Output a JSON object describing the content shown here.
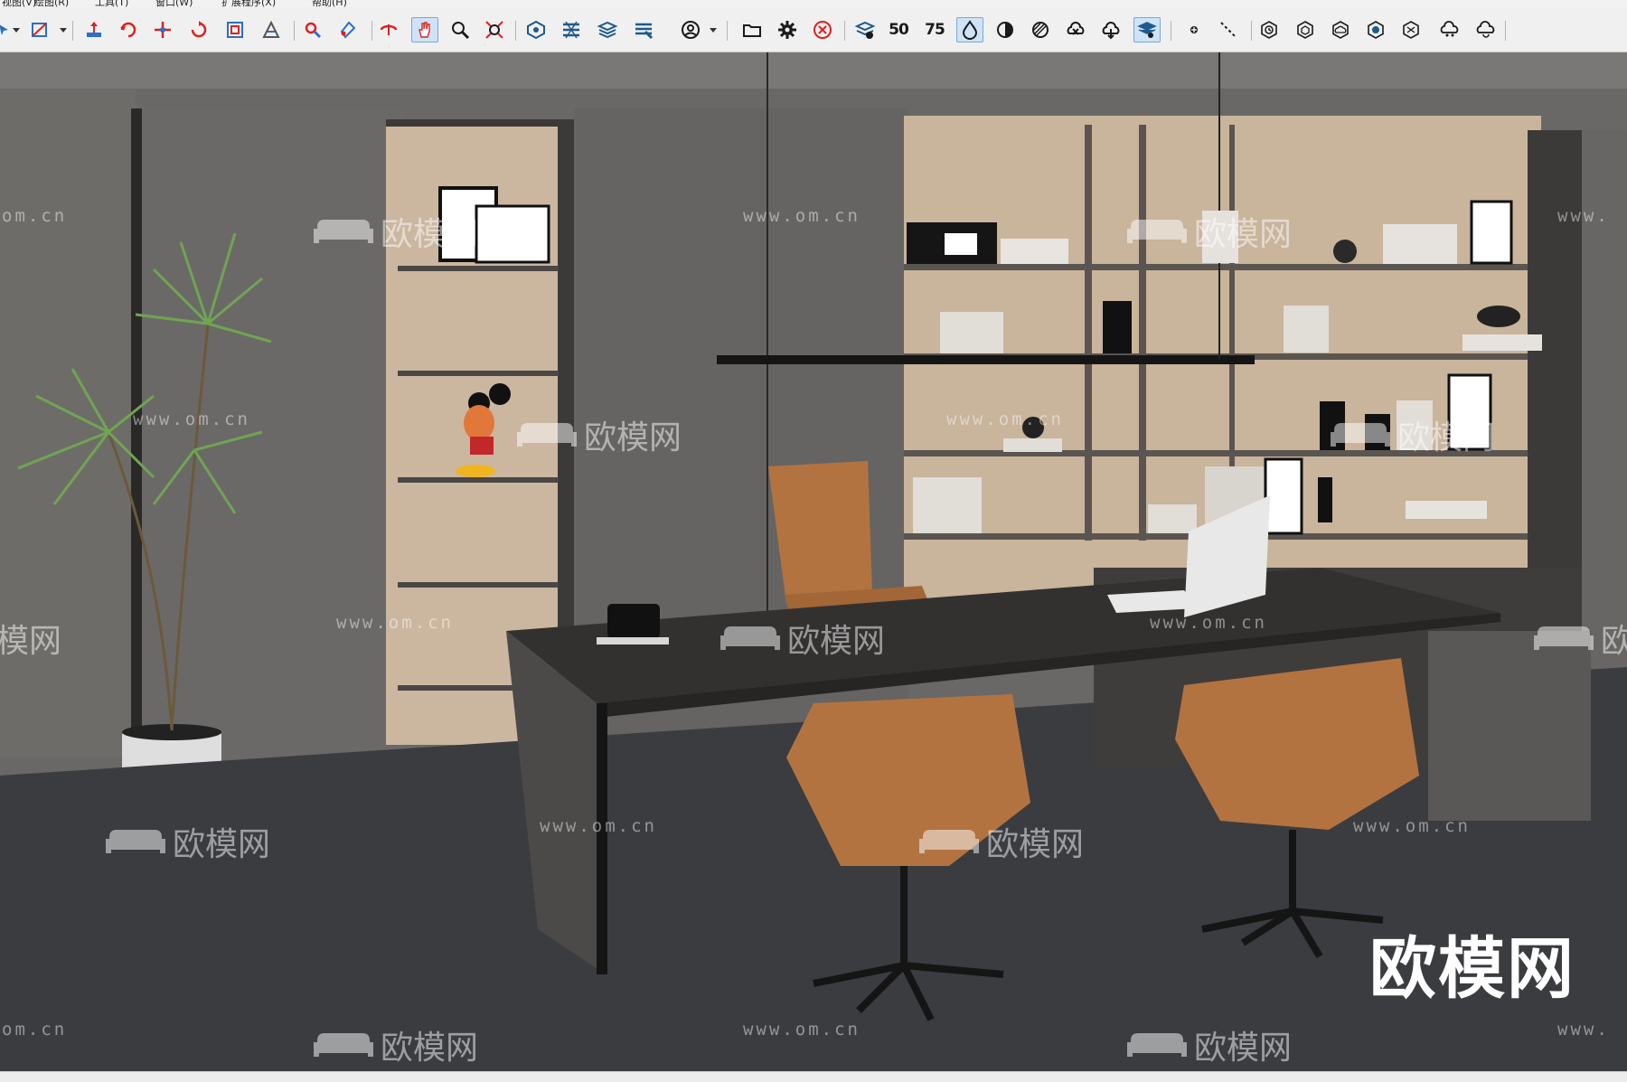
{
  "menubar": {
    "items": [
      "视图(V)",
      "绘图(R)",
      "工具(T)",
      "窗口(W)",
      "扩展程序(X)",
      "帮助(H)"
    ]
  },
  "toolbar": {
    "buttons": [
      {
        "name": "select-arrow-icon"
      },
      {
        "name": "rectangle-tool-icon"
      },
      {
        "name": "move-tool-icon"
      },
      {
        "name": "rotate-tool-icon"
      },
      {
        "name": "scale-tool-icon"
      },
      {
        "name": "offset-tool-icon"
      },
      {
        "name": "follow-me-icon"
      },
      {
        "name": "tape-measure-icon"
      },
      {
        "name": "text-tool-icon"
      },
      {
        "name": "paint-bucket-icon"
      },
      {
        "name": "orbit-icon"
      },
      {
        "name": "pan-hand-icon",
        "active": true
      },
      {
        "name": "zoom-icon"
      },
      {
        "name": "zoom-extents-icon"
      },
      {
        "name": "component-layers-icon"
      },
      {
        "name": "explode-icon"
      },
      {
        "name": "stack-layers-icon"
      },
      {
        "name": "stack-layers-2-icon"
      },
      {
        "name": "user-circle-icon"
      },
      {
        "name": "folder-open-icon"
      },
      {
        "name": "gear-icon"
      },
      {
        "name": "close-circle-icon"
      },
      {
        "name": "layers-view-icon"
      },
      {
        "name": "percent-50-icon",
        "label": "50"
      },
      {
        "name": "percent-75-icon",
        "label": "75"
      },
      {
        "name": "drop-shape-icon",
        "active": true
      },
      {
        "name": "half-circle-icon"
      },
      {
        "name": "hatched-circle-icon"
      },
      {
        "name": "cross-cloud-icon"
      },
      {
        "name": "cloud-download-icon"
      },
      {
        "name": "layer-touch-icon",
        "active": true
      },
      {
        "name": "dot-icon"
      },
      {
        "name": "dashed-line-icon"
      },
      {
        "name": "hex-clock-icon"
      },
      {
        "name": "hex-outline-icon"
      },
      {
        "name": "cloud-hex-icon"
      },
      {
        "name": "hex-globe-icon"
      },
      {
        "name": "hex-scissor-icon"
      },
      {
        "name": "cloud-share-icon"
      },
      {
        "name": "cloud-refresh-icon"
      }
    ]
  },
  "watermarks": {
    "url_text": "www.om.cn",
    "url_partial": "om.cn",
    "url_partial_right": "www.",
    "brand_text": "欧模网",
    "brand_partial": "欧模网"
  },
  "brand_mark": "欧模网",
  "colors": {
    "toolbar_bg": "#f0f0f0",
    "wall": "#6a6866",
    "wood": "#c7b39d",
    "chair_leather": "#b37340",
    "desk": "#3a3836",
    "floor": "#3b3d40"
  }
}
